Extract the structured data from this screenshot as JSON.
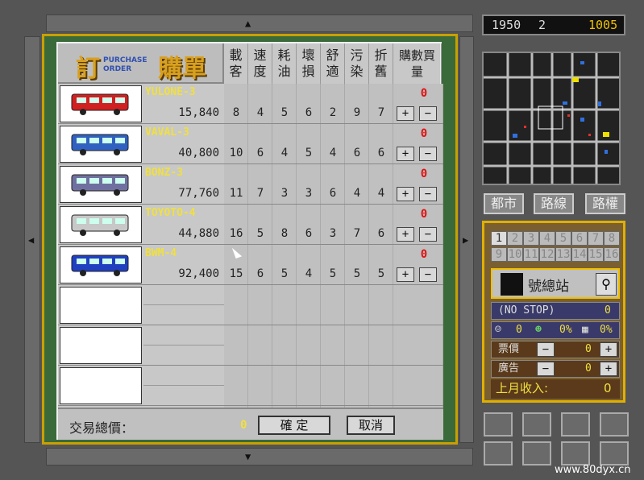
{
  "order": {
    "title_big_1": "訂",
    "title_small_1": "PURCHASE",
    "title_small_2": "ORDER",
    "title_big_2": "購單",
    "columns": [
      "載客",
      "速度",
      "耗油",
      "壞損",
      "舒適",
      "污染",
      "折舊",
      "購數買量"
    ],
    "rows": [
      {
        "name": "YULONE-3",
        "price": "15,840",
        "stats": [
          "8",
          "4",
          "5",
          "6",
          "2",
          "9",
          "7"
        ],
        "qty": "0",
        "bus_color": "#d02020"
      },
      {
        "name": "VAVAL-3",
        "price": "40,800",
        "stats": [
          "10",
          "6",
          "4",
          "5",
          "4",
          "6",
          "6"
        ],
        "qty": "0",
        "bus_color": "#3060c0"
      },
      {
        "name": "BONZ-3",
        "price": "77,760",
        "stats": [
          "11",
          "7",
          "3",
          "3",
          "6",
          "4",
          "4"
        ],
        "qty": "0",
        "bus_color": "#7070a0"
      },
      {
        "name": "TOYOTO-4",
        "price": "44,880",
        "stats": [
          "16",
          "5",
          "8",
          "6",
          "3",
          "7",
          "6"
        ],
        "qty": "0",
        "bus_color": "#c8c8c8"
      },
      {
        "name": "BWM-4",
        "price": "92,400",
        "stats": [
          "15",
          "6",
          "5",
          "4",
          "5",
          "5",
          "5"
        ],
        "qty": "0",
        "bus_color": "#2040c0"
      }
    ],
    "total_label": "交易總價：",
    "total_value": "0",
    "confirm_label": "確 定",
    "cancel_label": "取消",
    "plus": "+",
    "minus": "−"
  },
  "status": {
    "year": "1950",
    "month": "2",
    "money": "1005"
  },
  "nav": {
    "city": "都市",
    "route": "路線",
    "right": "路權"
  },
  "line_panel": {
    "numbers": [
      "1",
      "2",
      "3",
      "4",
      "5",
      "6",
      "7",
      "8",
      "9",
      "10",
      "11",
      "12",
      "13",
      "14",
      "15",
      "16"
    ],
    "station_label": "號總站",
    "no_stop": "(NO STOP)",
    "no_stop_count": "0",
    "pass_1": "0",
    "pass_2": "0%",
    "pass_3": "0%",
    "fare_label": "票價",
    "fare_value": "0",
    "ad_label": "廣告",
    "ad_value": "0",
    "income_label": "上月收入:",
    "income_value": "0"
  },
  "watermark": "www.80dyx.cn"
}
